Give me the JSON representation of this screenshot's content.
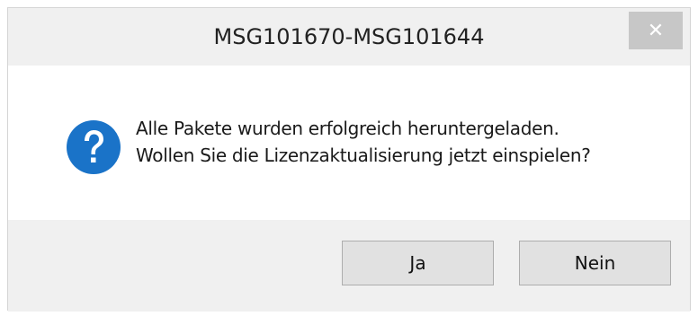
{
  "dialog": {
    "title": "MSG101670-MSG101644",
    "close_glyph": "✕",
    "icon": "question-icon",
    "accent_color": "#1a73c8",
    "message_lines": [
      "Alle Pakete wurden erfolgreich heruntergeladen.",
      "Wollen Sie die Lizenzaktualisierung jetzt einspielen?"
    ],
    "buttons": {
      "yes_label": "Ja",
      "no_label": "Nein"
    }
  }
}
